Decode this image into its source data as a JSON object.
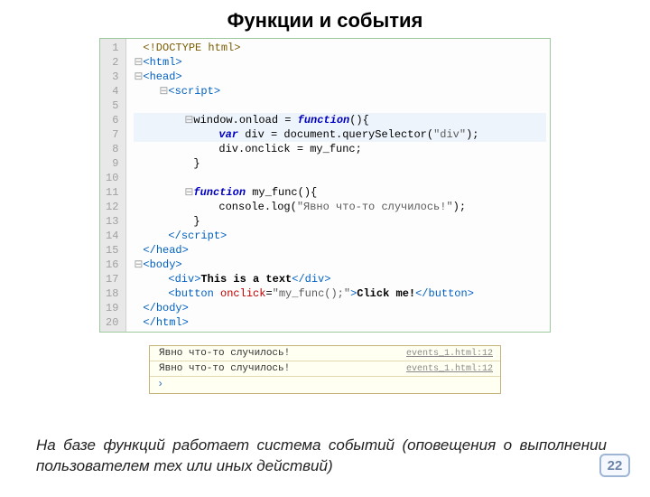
{
  "title": "Функции и события",
  "code": {
    "line_count": 20,
    "l1": "<!DOCTYPE html>",
    "l2_open": "<",
    "l2_tag": "html",
    "l2_close": ">",
    "l3_open": "<",
    "l3_tag": "head",
    "l3_close": ">",
    "l4_open": "<",
    "l4_tag": "script",
    "l4_close": ">",
    "l6_pre": "window.onload = ",
    "l6_kw": "function",
    "l6_post": "(){",
    "l7_kw": "var",
    "l7_mid": " div = document.querySelector(",
    "l7_str": "\"div\"",
    "l7_end": ");",
    "l8": "div.onclick = my_func;",
    "l9": "}",
    "l11_kw": "function",
    "l11_mid": " my_func(){",
    "l12_pre": "console.log(",
    "l12_str": "\"Явно что-то случилось!\"",
    "l12_end": ");",
    "l13": "}",
    "l14_open": "</",
    "l14_tag": "script",
    "l14_close": ">",
    "l15_open": "</",
    "l15_tag": "head",
    "l15_close": ">",
    "l16_open": "<",
    "l16_tag": "body",
    "l16_close": ">",
    "l17_open": "<",
    "l17_tag": "div",
    "l17_close": ">",
    "l17_text": "This is a text",
    "l17_c_open": "</",
    "l17_c_close": ">",
    "l18_open": "<",
    "l18_tag": "button",
    "l18_sp": " ",
    "l18_attr": "onclick",
    "l18_eq": "=",
    "l18_val": "\"my_func();\"",
    "l18_close": ">",
    "l18_text": "Click me!",
    "l18_c_open": "</",
    "l18_c_close": ">",
    "l19_open": "</",
    "l19_tag": "body",
    "l19_close": ">",
    "l20_open": "</",
    "l20_tag": "html",
    "l20_close": ">"
  },
  "console": {
    "rows": [
      {
        "msg": "Явно что-то случилось!",
        "src": "events_1.html:12"
      },
      {
        "msg": "Явно что-то случилось!",
        "src": "events_1.html:12"
      }
    ]
  },
  "caption": "На базе функций работает система событий (оповещения о выполнении пользователем тех или иных действий)",
  "page_number": "22"
}
